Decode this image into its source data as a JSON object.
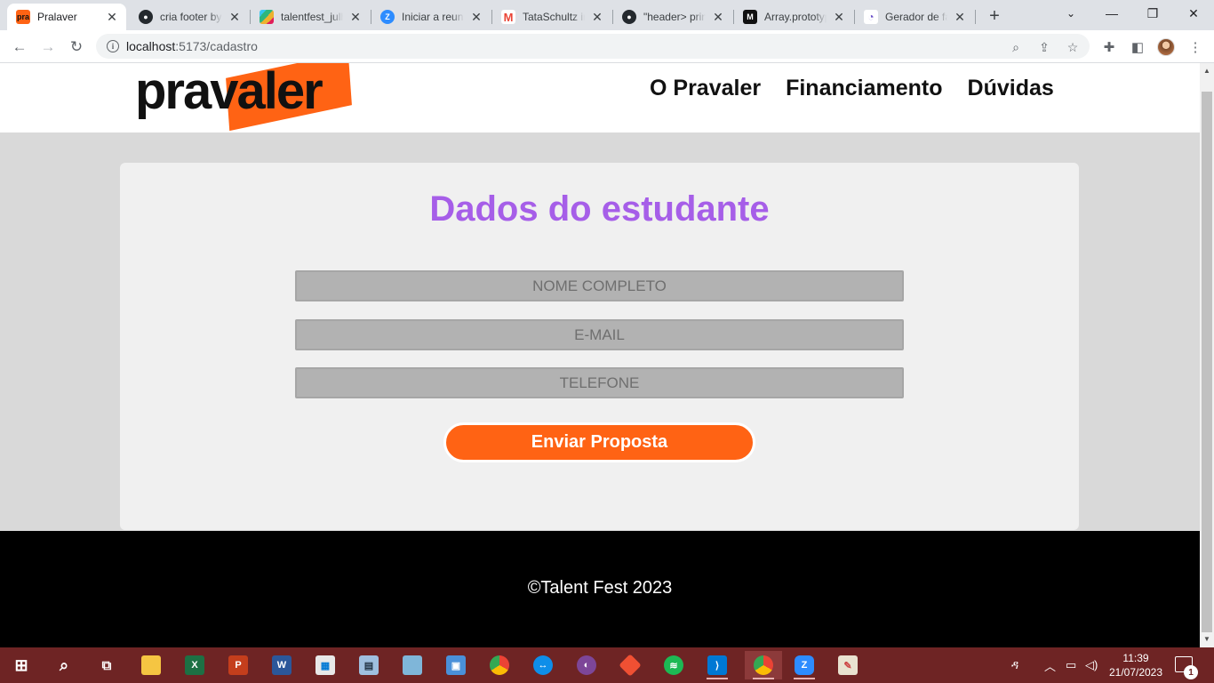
{
  "browser": {
    "tabs": [
      {
        "title": "Pralaver",
        "icon": "pravaler-favicon",
        "active": true
      },
      {
        "title": "cria footer by",
        "icon": "github-icon"
      },
      {
        "title": "talentfest_julh",
        "icon": "slack-icon"
      },
      {
        "title": "Iniciar a reuni",
        "icon": "zoom-icon"
      },
      {
        "title": "TataSchultz in",
        "icon": "gmail-icon"
      },
      {
        "title": "\"header> prin",
        "icon": "github-icon"
      },
      {
        "title": "Array.prototyp",
        "icon": "mdn-icon"
      },
      {
        "title": "Gerador de fa",
        "icon": "generator-icon"
      }
    ],
    "url_host": "localhost",
    "url_path": ":5173/cadastro"
  },
  "site": {
    "logo_text": "pravaler",
    "nav": [
      "O Pravaler",
      "Financiamento",
      "Dúvidas"
    ],
    "form": {
      "title": "Dados do estudante",
      "fields": [
        {
          "placeholder": "NOME COMPLETO",
          "value": ""
        },
        {
          "placeholder": "E-MAIL",
          "value": ""
        },
        {
          "placeholder": "TELEFONE",
          "value": ""
        }
      ],
      "submit_label": "Enviar Proposta"
    },
    "footer_text": "©Talent Fest 2023"
  },
  "taskbar": {
    "time": "11:39",
    "date": "21/07/2023",
    "notification_count": "1"
  },
  "colors": {
    "brand_orange": "#ff6314",
    "title_purple": "#a65ee8",
    "taskbar": "#6e2424"
  }
}
